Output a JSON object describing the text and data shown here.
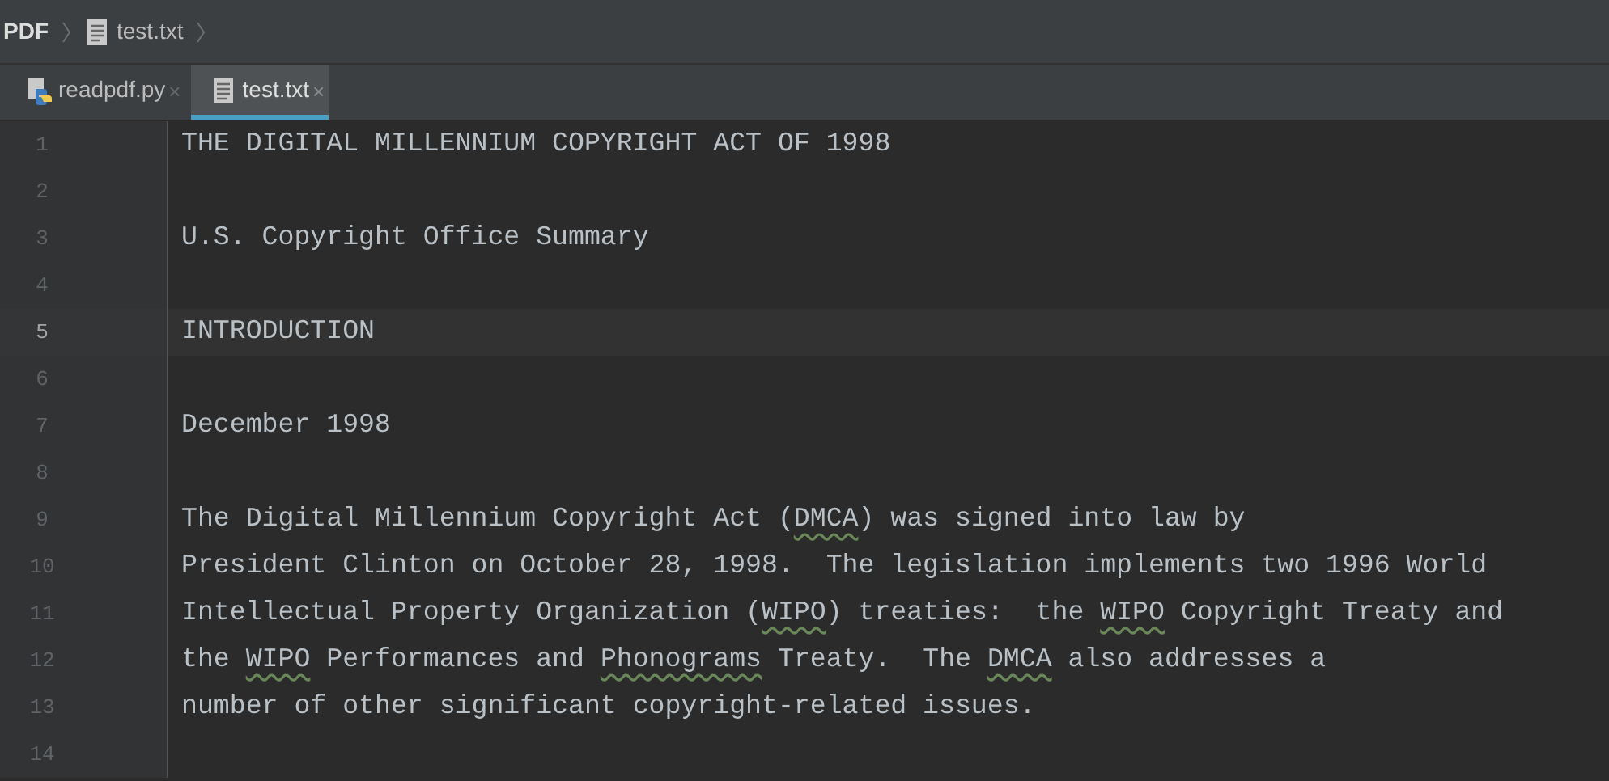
{
  "breadcrumbs": [
    {
      "label": "PDF",
      "kind": "folder"
    },
    {
      "label": "test.txt",
      "kind": "text-file"
    }
  ],
  "tabs": [
    {
      "label": "readpdf.py",
      "kind": "python-file",
      "selected": false,
      "close": "×"
    },
    {
      "label": "test.txt",
      "kind": "text-file",
      "selected": true,
      "close": "×"
    }
  ],
  "editor": {
    "lines": [
      {
        "number": "1",
        "current": false,
        "segments": [
          {
            "text": "THE DIGITAL MILLENNIUM COPYRIGHT ACT OF 1998",
            "flagged": false
          }
        ]
      },
      {
        "number": "2",
        "current": false
      },
      {
        "number": "3",
        "current": false,
        "segments": [
          {
            "text": "U.S. Copyright Office Summary",
            "flagged": false
          }
        ]
      },
      {
        "number": "4",
        "current": false
      },
      {
        "number": "5",
        "current": true,
        "segments": [
          {
            "text": "INTRODUCTION",
            "flagged": false
          }
        ]
      },
      {
        "number": "6",
        "current": false
      },
      {
        "number": "7",
        "current": false,
        "segments": [
          {
            "text": "December 1998",
            "flagged": false
          }
        ]
      },
      {
        "number": "8",
        "current": false
      },
      {
        "number": "9",
        "current": false,
        "segments": [
          {
            "text": "The Digital Millennium Copyright Act (",
            "flagged": false
          },
          {
            "text": "DMCA",
            "flagged": true
          },
          {
            "text": ") was signed into law by",
            "flagged": false
          }
        ]
      },
      {
        "number": "10",
        "current": false,
        "segments": [
          {
            "text": "President Clinton on October 28, 1998.  The legislation implements two 1996 World",
            "flagged": false
          }
        ]
      },
      {
        "number": "11",
        "current": false,
        "segments": [
          {
            "text": "Intellectual Property Organization (",
            "flagged": false
          },
          {
            "text": "WIPO",
            "flagged": true
          },
          {
            "text": ") treaties:  the ",
            "flagged": false
          },
          {
            "text": "WIPO",
            "flagged": true
          },
          {
            "text": " Copyright Treaty and",
            "flagged": false
          }
        ]
      },
      {
        "number": "12",
        "current": false,
        "segments": [
          {
            "text": "the ",
            "flagged": false
          },
          {
            "text": "WIPO",
            "flagged": true
          },
          {
            "text": " Performances and ",
            "flagged": false
          },
          {
            "text": "Phonograms",
            "flagged": true
          },
          {
            "text": " Treaty.  The ",
            "flagged": false
          },
          {
            "text": "DMCA",
            "flagged": true
          },
          {
            "text": " also addresses a",
            "flagged": false
          }
        ]
      },
      {
        "number": "13",
        "current": false,
        "segments": [
          {
            "text": "number of other significant copyright-related issues.",
            "flagged": false
          }
        ]
      },
      {
        "number": "14",
        "current": false
      }
    ]
  }
}
